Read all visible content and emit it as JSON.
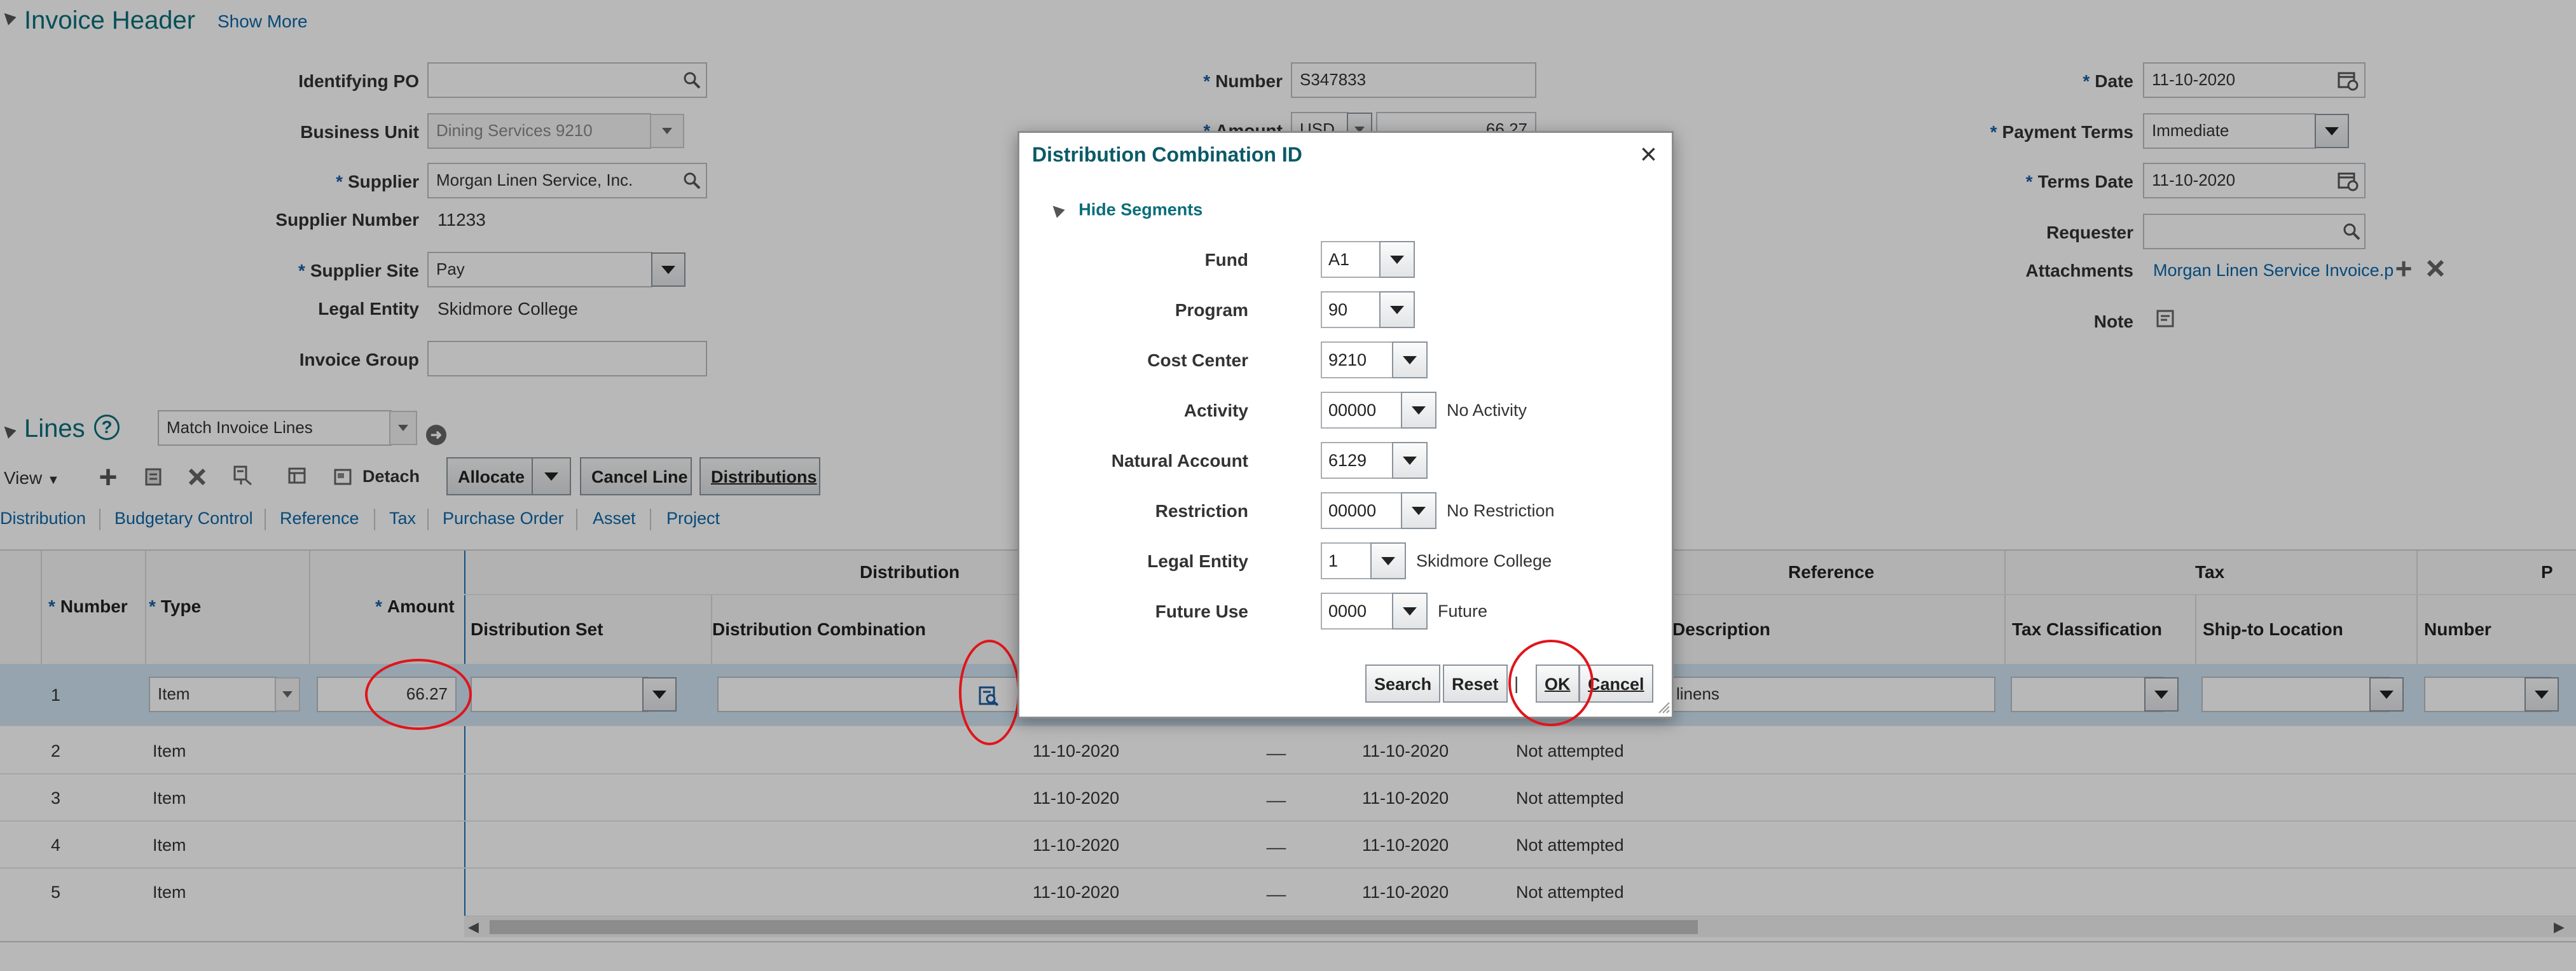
{
  "header": {
    "title": "Invoice Header",
    "show_more": "Show More",
    "fields": {
      "identifying_po": {
        "label": "Identifying PO",
        "value": ""
      },
      "business_unit": {
        "label": "Business Unit",
        "value": "Dining Services 9210"
      },
      "supplier": {
        "label": "Supplier",
        "value": "Morgan Linen Service, Inc."
      },
      "supplier_number": {
        "label": "Supplier Number",
        "value": "11233"
      },
      "supplier_site": {
        "label": "Supplier Site",
        "value": "Pay"
      },
      "legal_entity": {
        "label": "Legal Entity",
        "value": "Skidmore College"
      },
      "invoice_group": {
        "label": "Invoice Group",
        "value": ""
      },
      "number": {
        "label": "Number",
        "value": "S347833"
      },
      "amount": {
        "label": "Amount",
        "currency": "USD",
        "value": "66.27"
      },
      "date": {
        "label": "Date",
        "value": "11-10-2020"
      },
      "payment_terms": {
        "label": "Payment Terms",
        "value": "Immediate"
      },
      "terms_date": {
        "label": "Terms Date",
        "value": "11-10-2020"
      },
      "requester": {
        "label": "Requester",
        "value": ""
      },
      "attachments": {
        "label": "Attachments",
        "value": "Morgan Linen Service Invoice.p"
      },
      "note": {
        "label": "Note"
      }
    },
    "required_mark": "*"
  },
  "lines": {
    "title": "Lines",
    "match_select": "Match Invoice Lines",
    "toolbar": {
      "view": "View",
      "detach": "Detach",
      "allocate": "Allocate",
      "cancel_line": "Cancel Line",
      "distributions": "Distributions"
    },
    "tabs": [
      "Distribution",
      "Budgetary Control",
      "Reference",
      "Tax",
      "Purchase Order",
      "Asset",
      "Project"
    ],
    "groups": {
      "distribution": "Distribution",
      "reference": "Reference",
      "tax": "Tax",
      "p": "P"
    },
    "columns": {
      "number": "Number",
      "type": "Type",
      "amount": "Amount",
      "distribution_set": "Distribution Set",
      "distribution_combination": "Distribution Combination",
      "description": "Description",
      "tax_classification": "Tax Classification",
      "ship_to_location": "Ship-to Location",
      "po_number": "Number"
    },
    "rows": [
      {
        "number": "1",
        "type": "Item",
        "amount": "66.27",
        "description": "linens"
      },
      {
        "number": "2",
        "type": "Item",
        "date1": "11-10-2020",
        "dash": "__",
        "date2": "11-10-2020",
        "status": "Not attempted"
      },
      {
        "number": "3",
        "type": "Item",
        "date1": "11-10-2020",
        "dash": "__",
        "date2": "11-10-2020",
        "status": "Not attempted"
      },
      {
        "number": "4",
        "type": "Item",
        "date1": "11-10-2020",
        "dash": "__",
        "date2": "11-10-2020",
        "status": "Not attempted"
      },
      {
        "number": "5",
        "type": "Item",
        "date1": "11-10-2020",
        "dash": "__",
        "date2": "11-10-2020",
        "status": "Not attempted"
      }
    ]
  },
  "dialog": {
    "title": "Distribution Combination ID",
    "close": "×",
    "hide_segments": "Hide Segments",
    "segments": [
      {
        "label": "Fund",
        "value": "A1",
        "desc": ""
      },
      {
        "label": "Program",
        "value": "90",
        "desc": ""
      },
      {
        "label": "Cost Center",
        "value": "9210",
        "desc": ""
      },
      {
        "label": "Activity",
        "value": "00000",
        "desc": "No Activity"
      },
      {
        "label": "Natural Account",
        "value": "6129",
        "desc": ""
      },
      {
        "label": "Restriction",
        "value": "00000",
        "desc": "No Restriction"
      },
      {
        "label": "Legal Entity",
        "value": "1",
        "desc": "Skidmore College"
      },
      {
        "label": "Future Use",
        "value": "0000",
        "desc": "Future"
      }
    ],
    "buttons": {
      "search": "Search",
      "reset": "Reset",
      "separator": "|",
      "ok": "OK",
      "cancel": "Cancel"
    }
  },
  "colors": {
    "accent_teal": "#0a6e79",
    "link_blue": "#0b66a8",
    "annotation_red": "#e0151b",
    "overlay": "rgba(0,0,0,0.28)"
  },
  "icons": [
    "search-icon",
    "chevron-down-icon",
    "calendar-icon",
    "plus-icon",
    "close-icon",
    "help-icon",
    "go-arrow-icon",
    "note-icon",
    "combination-search-icon",
    "resize-grip-icon"
  ]
}
